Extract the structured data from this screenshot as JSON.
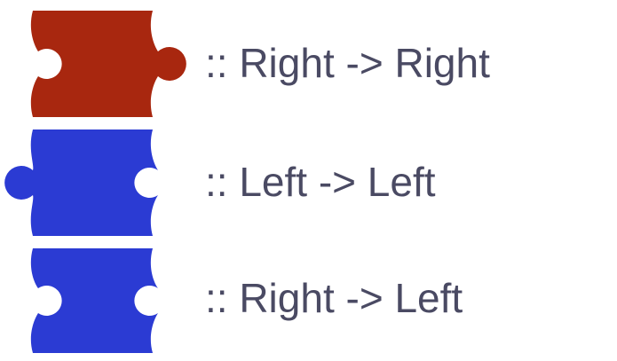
{
  "legend": {
    "rows": [
      {
        "label": ":: Right -> Right",
        "color": "#a8270f",
        "left_connector": "socket",
        "right_connector": "knob",
        "icon": "puzzle-piece-right-right-icon"
      },
      {
        "label": ":: Left -> Left",
        "color": "#2b3bd3",
        "left_connector": "knob",
        "right_connector": "socket",
        "icon": "puzzle-piece-left-left-icon"
      },
      {
        "label": ":: Right -> Left",
        "color": "#2b3bd3",
        "left_connector": "socket",
        "right_connector": "socket",
        "icon": "puzzle-piece-right-left-icon"
      }
    ]
  }
}
